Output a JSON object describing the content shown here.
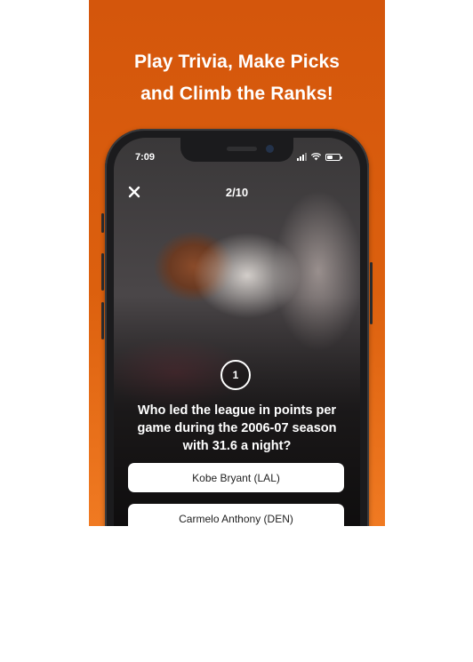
{
  "headline": {
    "line1": "Play Trivia, Make Picks",
    "line2": "and Climb the Ranks!"
  },
  "status_bar": {
    "time": "7:09",
    "icons": [
      "signal-icon",
      "wifi-icon",
      "battery-icon"
    ]
  },
  "quiz": {
    "close_icon": "close-icon",
    "progress": "2/10",
    "question_number": "1",
    "question": "Who led the league in points per game during the 2006-07 season with 31.6 a night?",
    "options": [
      {
        "label": "Kobe Bryant (LAL)"
      },
      {
        "label": "Carmelo Anthony (DEN)"
      }
    ]
  },
  "colors": {
    "promo_background": "#d4560c",
    "text": "#ffffff",
    "option_background": "#ffffff"
  }
}
